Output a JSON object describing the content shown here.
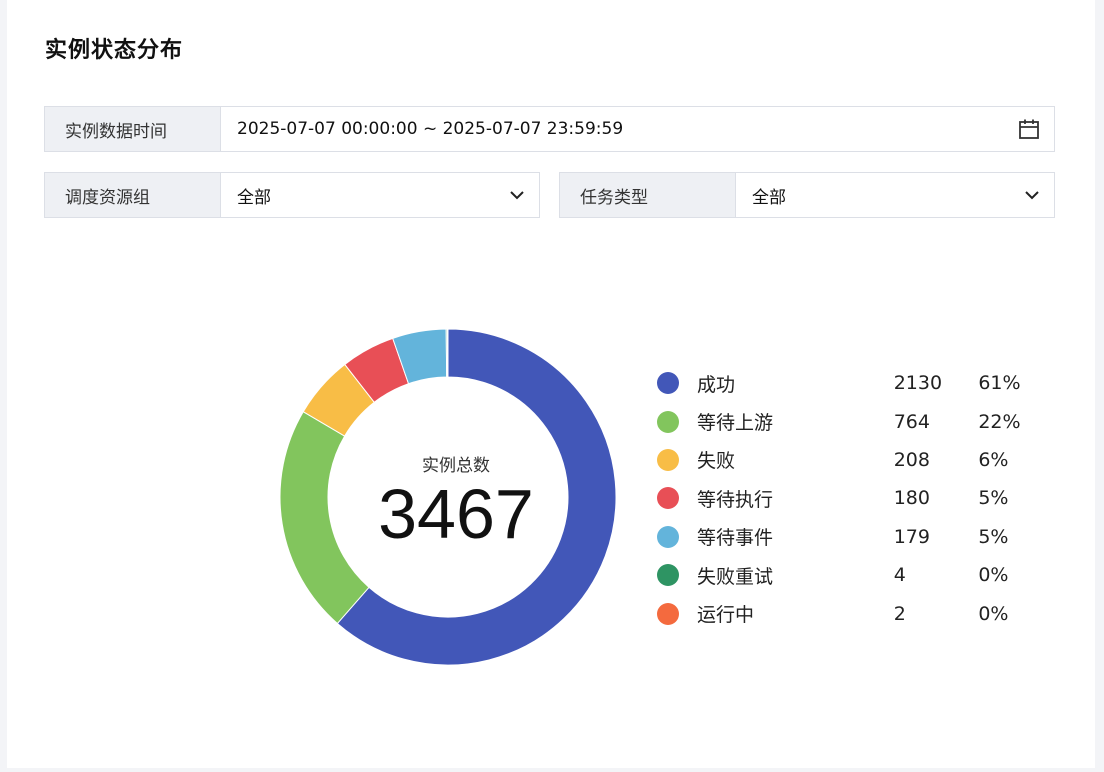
{
  "panel": {
    "title": "实例状态分布"
  },
  "filters": {
    "time": {
      "label": "实例数据时间",
      "value": "2025-07-07 00:00:00  ~ 2025-07-07 23:59:59"
    },
    "resource_group": {
      "label": "调度资源组",
      "value": "全部"
    },
    "task_type": {
      "label": "任务类型",
      "value": "全部"
    }
  },
  "icons": {
    "calendar": "calendar-icon",
    "chevron": "chevron-down-icon"
  },
  "chart_data": {
    "type": "pie",
    "center_label": "实例总数",
    "total": "3467",
    "series": [
      {
        "name": "成功",
        "value": 2130,
        "percent": "61%",
        "color": "#4257b8"
      },
      {
        "name": "等待上游",
        "value": 764,
        "percent": "22%",
        "color": "#82c55d"
      },
      {
        "name": "失败",
        "value": 208,
        "percent": "6%",
        "color": "#f8bd46"
      },
      {
        "name": "等待执行",
        "value": 180,
        "percent": "5%",
        "color": "#e84f56"
      },
      {
        "name": "等待事件",
        "value": 179,
        "percent": "5%",
        "color": "#63b4db"
      },
      {
        "name": "失败重试",
        "value": 4,
        "percent": "0%",
        "color": "#2e9463"
      },
      {
        "name": "运行中",
        "value": 2,
        "percent": "0%",
        "color": "#f46a3e"
      }
    ]
  }
}
